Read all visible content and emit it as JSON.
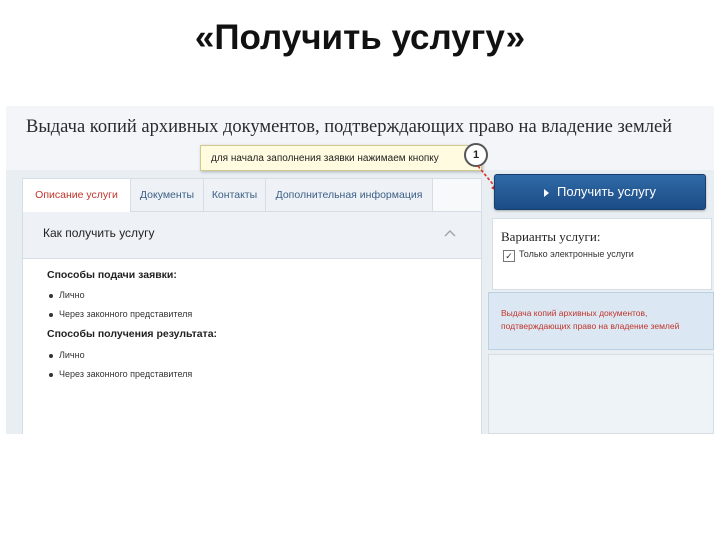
{
  "slide": {
    "title": "«Получить услугу»"
  },
  "service": {
    "title": "Выдача копий архивных документов, подтверждающих право на владение землей"
  },
  "hint": {
    "text": "для начала заполнения заявки нажимаем кнопку",
    "number": "1"
  },
  "tabs": [
    {
      "label": "Описание услуги",
      "active": true
    },
    {
      "label": "Документы",
      "active": false
    },
    {
      "label": "Контакты",
      "active": false
    },
    {
      "label": "Дополнительная информация",
      "active": false
    }
  ],
  "accordion": {
    "title": "Как получить услугу"
  },
  "submission": {
    "title": "Способы подачи заявки:",
    "items": [
      "Лично",
      "Через законного представителя"
    ]
  },
  "result": {
    "title": "Способы получения результата:",
    "items": [
      "Лично",
      "Через законного представителя"
    ]
  },
  "action": {
    "label": "Получить услугу"
  },
  "variants": {
    "title": "Варианты услуги:",
    "checkbox_label": "Только электронные услуги",
    "checked": true,
    "items": [
      "Выдача копий архивных документов, подтверждающих право на владение землей"
    ]
  },
  "colors": {
    "accent": "#c0362c",
    "button": "#1f5592",
    "link": "#3c5f86"
  }
}
